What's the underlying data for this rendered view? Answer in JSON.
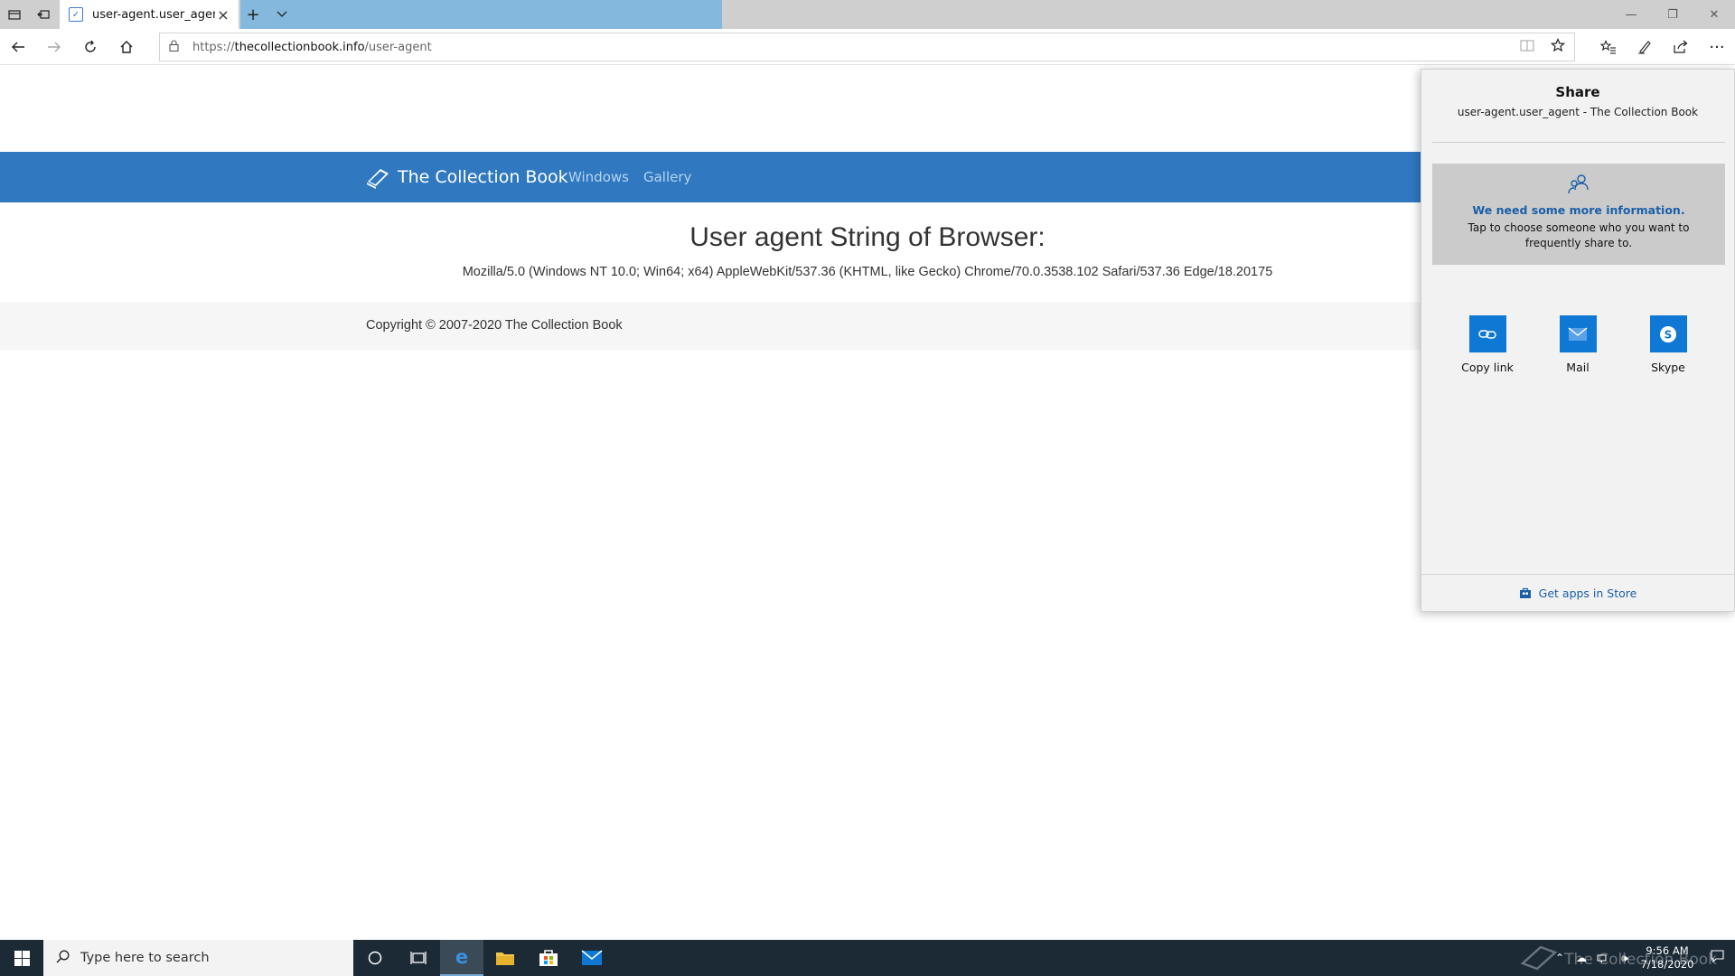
{
  "browser": {
    "tab_title": "user-agent.user_agent -",
    "address": {
      "scheme": "https://",
      "domain": "thecollectionbook.info",
      "path": "/user-agent"
    }
  },
  "site": {
    "brand": "The Collection Book",
    "nav": [
      "Windows",
      "Gallery"
    ],
    "heading": "User agent String of Browser:",
    "user_agent": "Mozilla/5.0 (Windows NT 10.0; Win64; x64) AppleWebKit/537.36 (KHTML, like Gecko) Chrome/70.0.3538.102 Safari/537.36 Edge/18.20175",
    "copyright": "Copyright © 2007-2020 The Collection Book",
    "header_color": "#3078c0"
  },
  "share": {
    "title": "Share",
    "subtitle": "user-agent.user_agent - The Collection Book",
    "info_heading": "We need some more information.",
    "info_body": "Tap to choose someone who you want to frequently share to.",
    "apps": [
      {
        "label": "Copy link",
        "icon": "link-icon"
      },
      {
        "label": "Mail",
        "icon": "mail-icon"
      },
      {
        "label": "Skype",
        "icon": "skype-icon"
      }
    ],
    "store_link": "Get apps in Store",
    "accent_color": "#0f78d4"
  },
  "taskbar": {
    "search_placeholder": "Type here to search",
    "time": "9:56 AM",
    "date": "7/18/2020",
    "watermark": "The Collection Book"
  }
}
